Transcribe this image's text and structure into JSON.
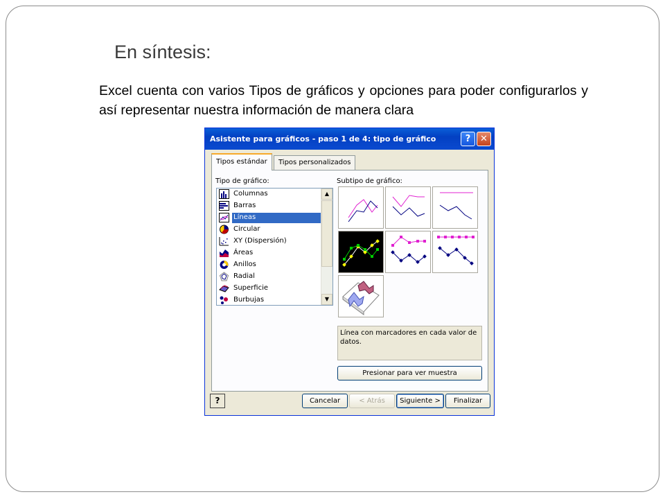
{
  "slide": {
    "title": "En síntesis:",
    "body": "Excel cuenta con  varios Tipos de gráficos y opciones para poder configurarlos y así representar nuestra información de manera clara"
  },
  "dialog": {
    "title": "Asistente para gráficos - paso 1 de 4: tipo de gráfico",
    "help_glyph": "?",
    "close_glyph": "✕",
    "tabs": [
      {
        "label": "Tipos estándar",
        "active": true
      },
      {
        "label": "Tipos personalizados",
        "active": false
      }
    ],
    "chart_type_label": "Tipo de gráfico:",
    "chart_types": [
      {
        "label": "Columnas",
        "icon": "column-chart-icon"
      },
      {
        "label": "Barras",
        "icon": "bar-chart-icon"
      },
      {
        "label": "Líneas",
        "icon": "line-chart-icon",
        "selected": true
      },
      {
        "label": "Circular",
        "icon": "pie-chart-icon"
      },
      {
        "label": "XY (Dispersión)",
        "icon": "scatter-chart-icon"
      },
      {
        "label": "Áreas",
        "icon": "area-chart-icon"
      },
      {
        "label": "Anillos",
        "icon": "doughnut-chart-icon"
      },
      {
        "label": "Radial",
        "icon": "radar-chart-icon"
      },
      {
        "label": "Superficie",
        "icon": "surface-chart-icon"
      },
      {
        "label": "Burbujas",
        "icon": "bubble-chart-icon"
      }
    ],
    "subtype_label": "Subtipo de gráfico:",
    "subtype_selected_index": 3,
    "description": "Línea con marcadores en cada valor de datos.",
    "preview_button": "Presionar para ver muestra",
    "buttons": {
      "help": "?",
      "cancel": "Cancelar",
      "back": "< Atrás",
      "next": "Siguiente >",
      "finish": "Finalizar"
    },
    "colors": {
      "titlebar": "#0a5fd8",
      "selection": "#316ac5",
      "series_magenta": "#e020d0",
      "series_navy": "#000080"
    }
  }
}
